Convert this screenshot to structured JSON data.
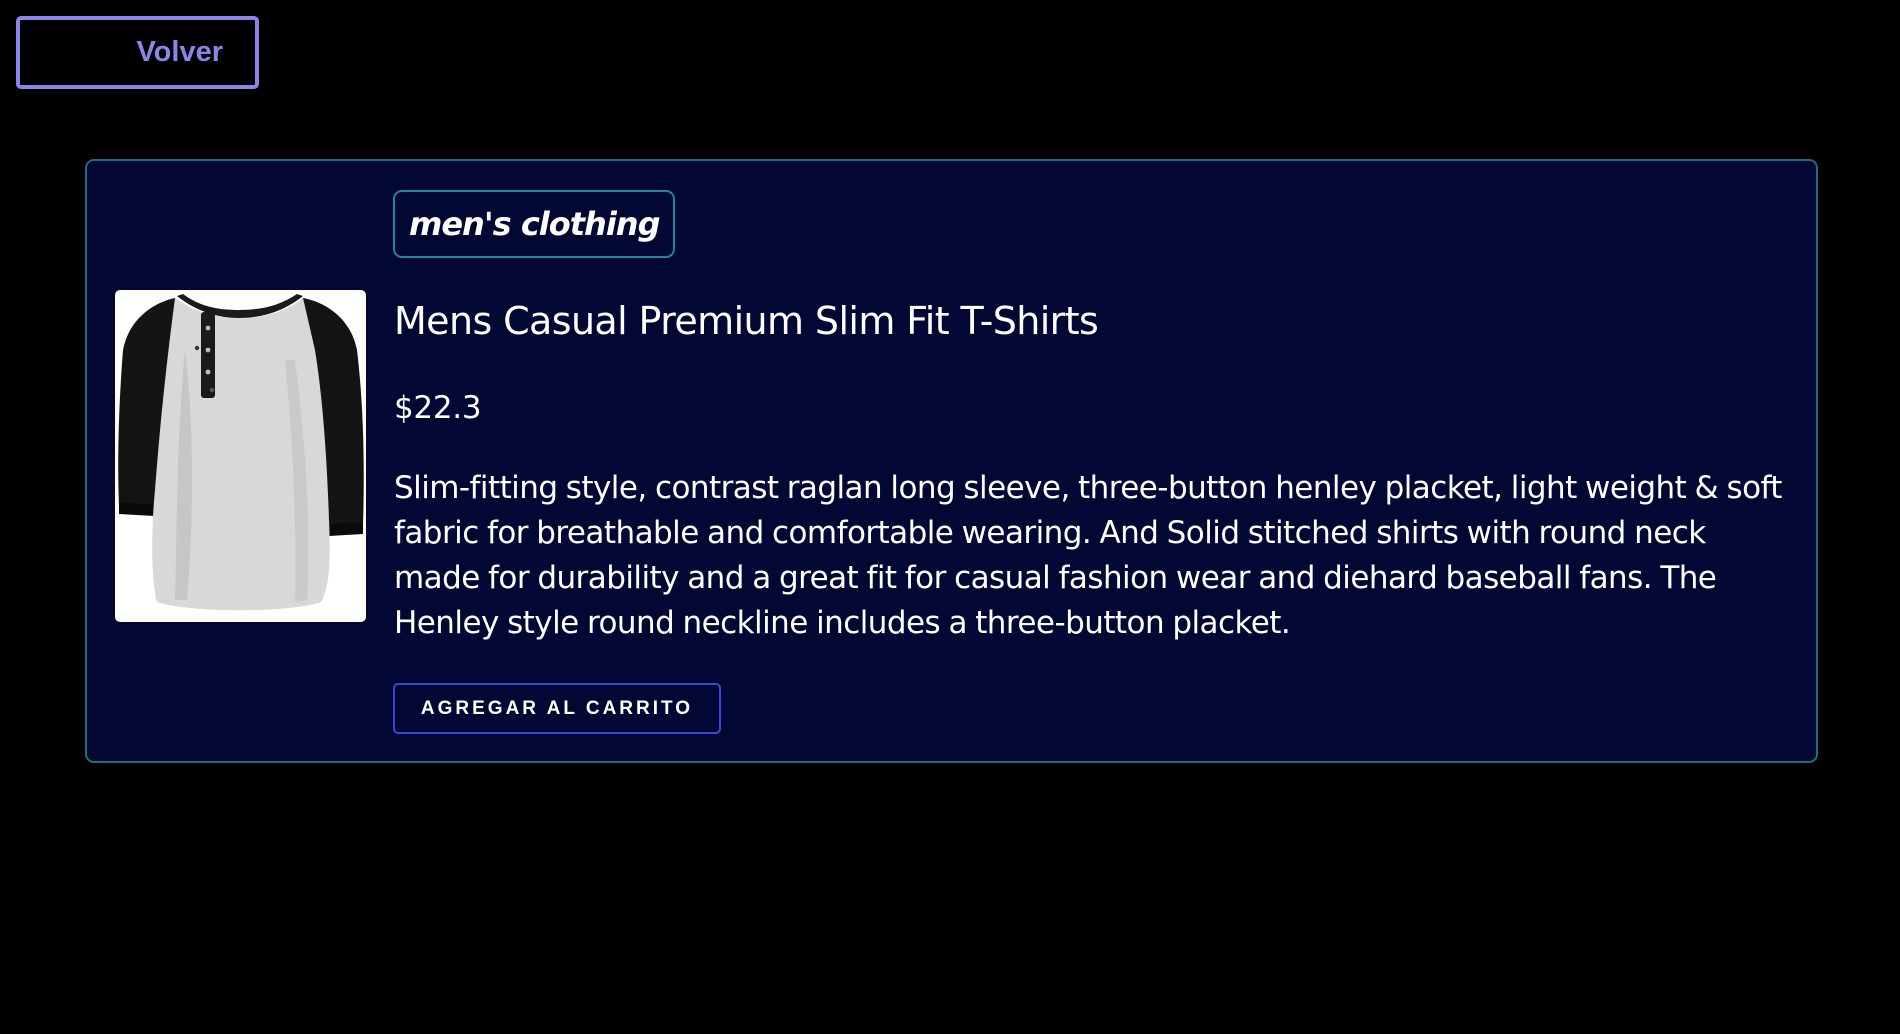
{
  "nav": {
    "back_label": "Volver"
  },
  "product": {
    "category": "men's clothing",
    "title": "Mens Casual Premium Slim Fit T-Shirts",
    "price": "$22.3",
    "description": "Slim-fitting style, contrast raglan long sleeve, three-button henley placket, light weight & soft fabric for breathable and comfortable wearing. And Solid stitched shirts with round neck made for durability and a great fit for casual fashion wear and diehard baseball fans. The Henley style round neckline includes a three-button placket.",
    "add_to_cart_label": "AGREGAR AL CARRITO",
    "image_icon": "raglan-henley-shirt-image"
  },
  "colors": {
    "page_background": "#000000",
    "card_background": "#020733",
    "card_border": "#1f6f7a",
    "accent": "#8b85e8",
    "button_border": "#3a48d8"
  }
}
